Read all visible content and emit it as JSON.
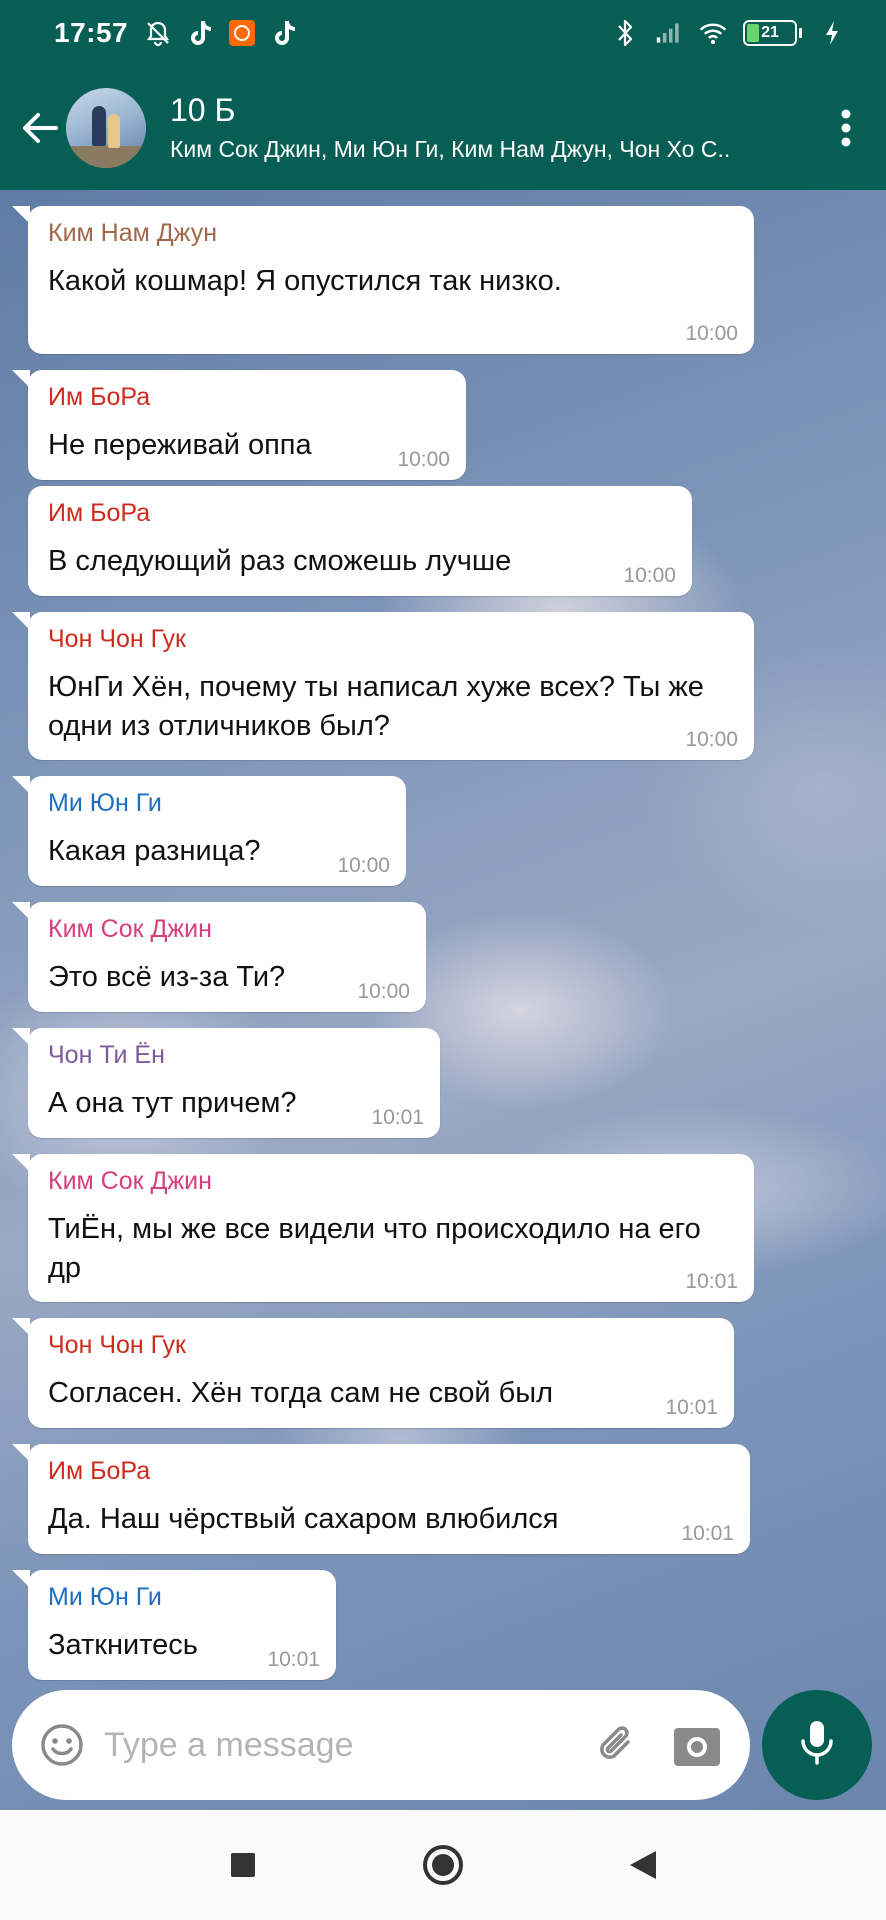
{
  "status_bar": {
    "time": "17:57",
    "battery": "21"
  },
  "header": {
    "title": "10 Б",
    "subtitle": "Ким Сок Джин, Ми Юн Ги, Ким Нам Джун, Чон Хо С..",
    "brand_color": "#075e54"
  },
  "messages": [
    {
      "sender": "Ким Нам Джун",
      "text": "Какой кошмар! Я опустился так низко.",
      "time": "10:00",
      "sender_color": "#a0684a"
    },
    {
      "sender": "Им БоРа",
      "text": "Не переживай оппа",
      "time": "10:00",
      "sender_color": "#cf2a1c"
    },
    {
      "sender": "Им БоРа",
      "text": "В следующий раз сможешь лучше",
      "time": "10:00",
      "sender_color": "#cf2a1c"
    },
    {
      "sender": "Чон Чон Гук",
      "text": "ЮнГи Хён, почему ты написал хуже всех? Ты же одни из отличников был?",
      "time": "10:00",
      "sender_color": "#cf2a1c"
    },
    {
      "sender": "Ми Юн Ги",
      "text": "Какая разница?",
      "time": "10:00",
      "sender_color": "#1d6fc2"
    },
    {
      "sender": "Ким Сок Джин",
      "text": "Это всё из-за Ти?",
      "time": "10:00",
      "sender_color": "#d6407a"
    },
    {
      "sender": "Чон Ти Ён",
      "text": "А она тут причем?",
      "time": "10:01",
      "sender_color": "#7d5a9b"
    },
    {
      "sender": "Ким Сок Джин",
      "text": "ТиЁн, мы же все видели что происходило на его др",
      "time": "10:01",
      "sender_color": "#d6407a"
    },
    {
      "sender": "Чон Чон Гук",
      "text": "Согласен. Хён тогда сам не свой был",
      "time": "10:01",
      "sender_color": "#cf2a1c"
    },
    {
      "sender": "Им БоРа",
      "text": "Да. Наш чёрствый сахаром влюбился",
      "time": "10:01",
      "sender_color": "#cf2a1c"
    },
    {
      "sender": "Ми Юн Ги",
      "text": "Заткнитесь",
      "time": "10:01",
      "sender_color": "#1d6fc2"
    }
  ],
  "composer": {
    "placeholder": "Type a message"
  },
  "icons": {
    "status_left": [
      "mute-bell-icon",
      "tiktok-icon",
      "mi-app-icon",
      "tiktok-icon"
    ],
    "status_right": [
      "bluetooth-icon",
      "signal-icon",
      "wifi-icon",
      "battery-icon",
      "charging-icon"
    ],
    "header": [
      "back-arrow-icon",
      "more-vert-icon"
    ],
    "composer": [
      "emoji-icon",
      "attach-icon",
      "camera-icon",
      "mic-icon"
    ],
    "nav": [
      "recents-square-icon",
      "home-circle-icon",
      "back-triangle-icon"
    ]
  }
}
